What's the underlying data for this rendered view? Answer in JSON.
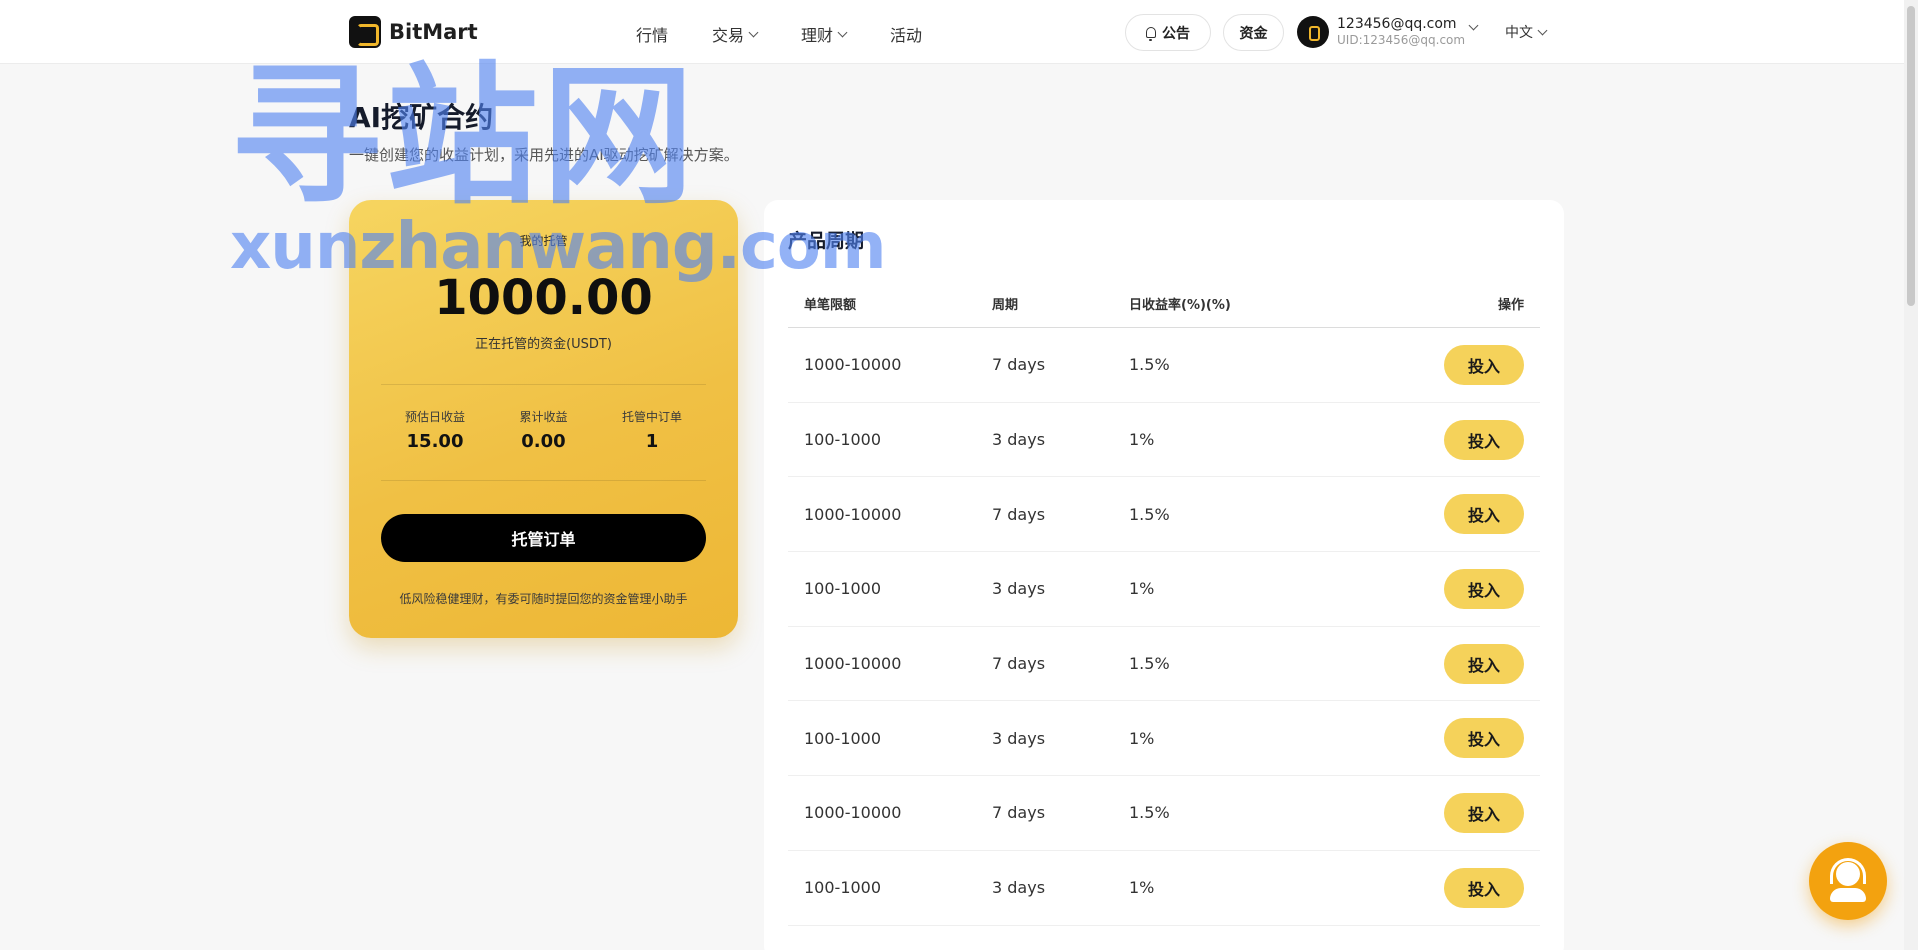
{
  "header": {
    "logo_text": "BitMart",
    "nav": [
      {
        "label": "行情",
        "has_dropdown": false
      },
      {
        "label": "交易",
        "has_dropdown": true
      },
      {
        "label": "理财",
        "has_dropdown": true
      },
      {
        "label": "活动",
        "has_dropdown": false
      }
    ],
    "notice_label": "公告",
    "assets_label": "资金",
    "user_email": "123456@qq.com",
    "user_uid": "UID:123456@qq.com",
    "language": "中文"
  },
  "watermark": {
    "line1": "寻站网",
    "line2": "xunzhanwang.com"
  },
  "page": {
    "title": "AI挖矿合约",
    "subtitle": "一键创建您的收益计划，采用先进的AI驱动挖矿解决方案。"
  },
  "custody_card": {
    "label": "我的托管",
    "amount": "1000.00",
    "amount_desc": "正在托管的资金(USDT)",
    "stats": [
      {
        "label": "预估日收益",
        "value": "15.00"
      },
      {
        "label": "累计收益",
        "value": "0.00"
      },
      {
        "label": "托管中订单",
        "value": "1"
      }
    ],
    "button_label": "托管订单",
    "footer": "低风险稳健理财，有委可随时提回您的资金管理小助手"
  },
  "products": {
    "title": "产品周期",
    "columns": [
      "单笔限额",
      "周期",
      "日收益率(%)(%)",
      "操作"
    ],
    "rows": [
      {
        "limit": "1000-10000",
        "period": "7 days",
        "rate": "1.5%",
        "action": "投入"
      },
      {
        "limit": "100-1000",
        "period": "3 days",
        "rate": "1%",
        "action": "投入"
      },
      {
        "limit": "1000-10000",
        "period": "7 days",
        "rate": "1.5%",
        "action": "投入"
      },
      {
        "limit": "100-1000",
        "period": "3 days",
        "rate": "1%",
        "action": "投入"
      },
      {
        "limit": "1000-10000",
        "period": "7 days",
        "rate": "1.5%",
        "action": "投入"
      },
      {
        "limit": "100-1000",
        "period": "3 days",
        "rate": "1%",
        "action": "投入"
      },
      {
        "limit": "1000-10000",
        "period": "7 days",
        "rate": "1.5%",
        "action": "投入"
      },
      {
        "limit": "100-1000",
        "period": "3 days",
        "rate": "1%",
        "action": "投入"
      }
    ]
  },
  "colors": {
    "accent": "#f5d25a",
    "card_gradient_start": "#f6d560",
    "card_gradient_end": "#edb735",
    "support": "#f3a20f"
  }
}
